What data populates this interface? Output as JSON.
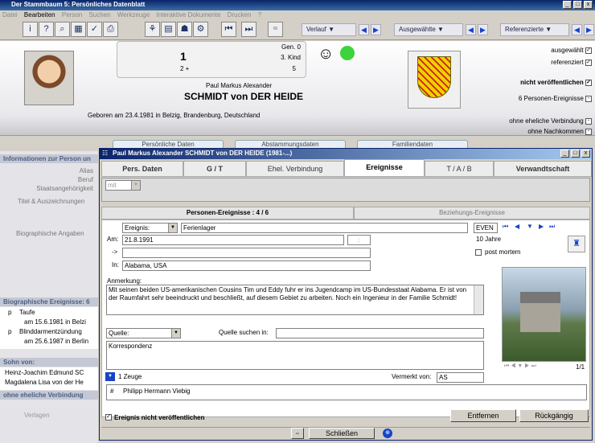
{
  "window": {
    "title": "Der Stammbaum 5: Persönliches Datenblatt"
  },
  "menu": [
    "Datei",
    "Bearbeiten",
    "Person",
    "Suchen",
    "Werkzeuge",
    "Interaktive Dokumente",
    "Drucken",
    "?"
  ],
  "toolbar": {
    "verlauf": "Verlauf",
    "ausgewaehlte": "Ausgewählte",
    "referenzierte": "Referenzierte"
  },
  "header": {
    "gen": "Gen. 0",
    "number": "1",
    "kind": "3. Kind",
    "left_num": "2 +",
    "right_num": "5",
    "given_name": "Paul Markus Alexander",
    "surname": "SCHMIDT von DER HEIDE",
    "born": "Geboren am 23.4.1981 in Belzig, Brandenburg, Deutschland",
    "flags": {
      "ausgewaehlt": "ausgewählt",
      "referenziert": "referenziert",
      "nicht_veroeff": "nicht veröffentlichen",
      "personen_ereignisse": "6 Personen-Ereignisse",
      "ohne_ehel": "ohne eheliche Verbindung",
      "ohne_nachkommen": "ohne Nachkommen"
    },
    "tabs": [
      "Persönliche Daten",
      "Abstammungsdaten",
      "Familiendaten"
    ]
  },
  "left": {
    "info_header": "Informationen zur Person un",
    "fields": [
      "Alias",
      "Beruf",
      "Staatsangehörigkeit",
      "Titel & Auszeichnungen",
      "Biographische Angaben"
    ],
    "bio_header": "Biographische Ereignisse: 6",
    "events": [
      {
        "mark": "p",
        "name": "Taufe",
        "date": "am 15.6.1981 in Belzi"
      },
      {
        "mark": "p",
        "name": "Blinddarmentzündung",
        "date": "am 25.6.1987 in Berlin"
      }
    ],
    "sohn_header": "Sohn von:",
    "parents": [
      "Heinz-Joachim Edmund SC",
      "Magdalena Lisa von der He"
    ],
    "ohne_header": "ohne eheliche Verbindung",
    "verlagen": "Verlagen"
  },
  "dialog": {
    "title": "Paul Markus Alexander SCHMIDT von DER HEIDE (1981-...)",
    "tabs": [
      "Pers. Daten",
      "G / T",
      "Ehel. Verbindung",
      "Ereignisse",
      "T / A / B",
      "Verwandtschaft"
    ],
    "mit": "mit",
    "sub_active": "Personen-Ereignisse : 4 / 6",
    "sub_other": "Beziehungs-Ereignisse",
    "ereignis_label": "Ereignis:",
    "ereignis_value": "Ferienlager",
    "ereignis_code": "EVEN",
    "am_label": "Am:",
    "am_value": "21.8.1991",
    "arrow_label": "->",
    "in_label": "In:",
    "in_value": "Alabama, USA",
    "age": "10 Jahre",
    "post_mortem": "post mortem",
    "anmerkung_label": "Anmerkung:",
    "anmerkung": "Mit seinen beiden US-amerikanischen Cousins Tim und Eddy fuhr er ins Jugendcamp im US-Bundesstaat Alabama.  Er ist von der Raumfahrt sehr beeindruckt und beschließt, auf diesem Gebiet zu arbeiten. Noch ein Ingenieur in der Familie Schmidt!",
    "quelle_label": "Quelle:",
    "quelle_suchen": "Quelle suchen in:",
    "quelle_text": "Korrespondenz",
    "zeuge": "1 Zeuge",
    "vermerkt_label": "Vermerkt von:",
    "vermerkt_value": "AS",
    "zeuge_mark": "#",
    "zeuge_name": "Philipp Hermann Viebig",
    "img_count": "1/1",
    "nicht_veroeff": "Ereignis nicht veröffentlichen",
    "entfernen": "Entfernen",
    "rueckgaengig": "Rückgängig"
  },
  "statusbar": {
    "schliessen": "Schließen"
  },
  "colors": {
    "title_blue": "#0a246a",
    "accent_green": "#3cd43c",
    "nav_blue": "#1644c8",
    "coat_red": "#cc1f1f",
    "coat_gold": "#f0d000"
  }
}
